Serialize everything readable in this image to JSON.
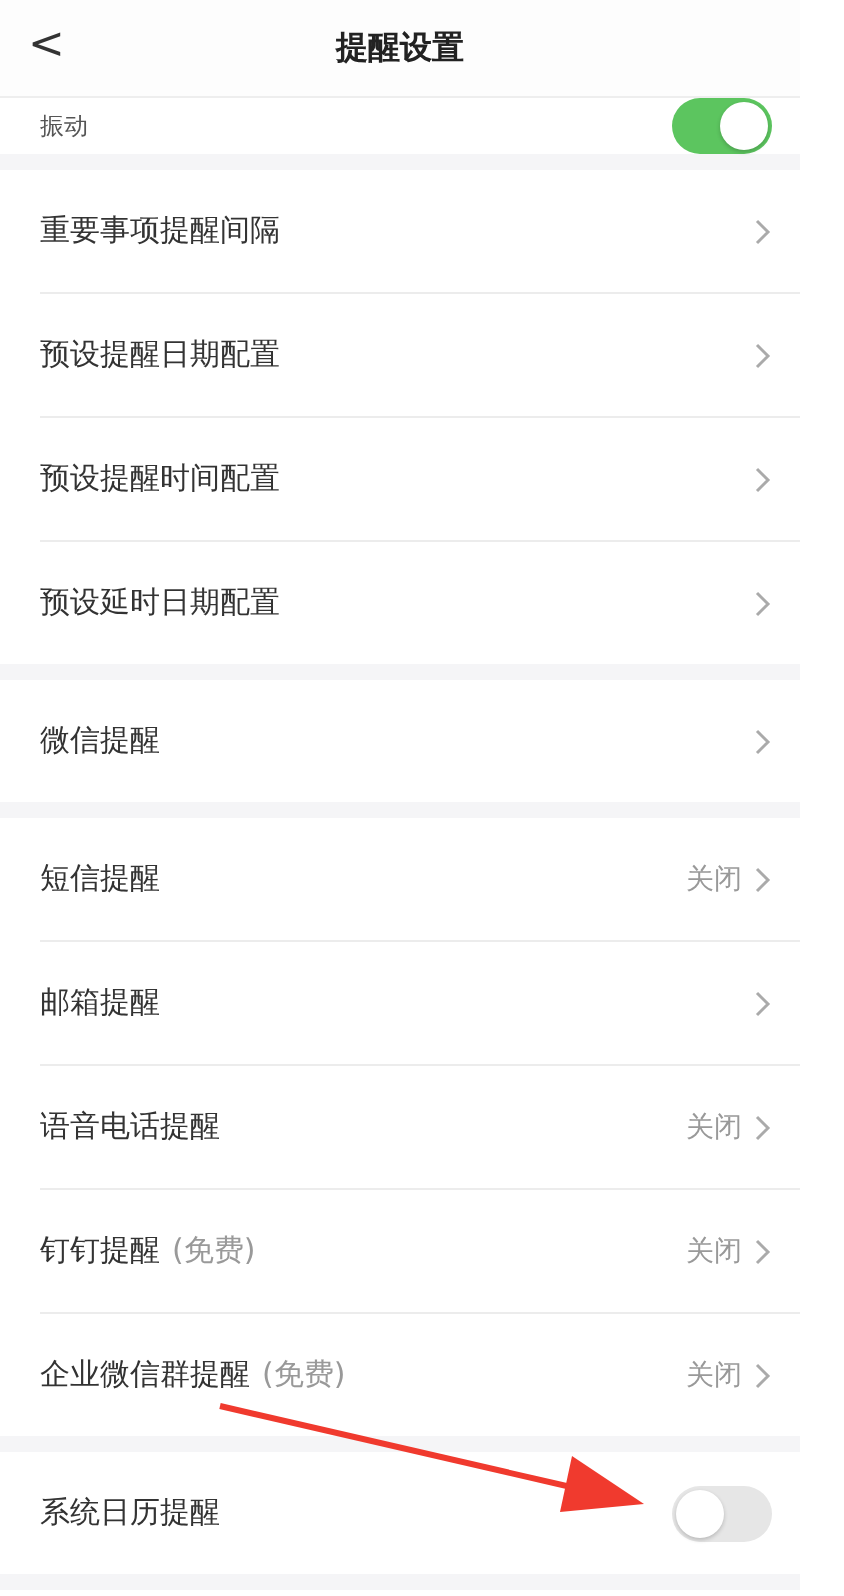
{
  "header": {
    "title": "提醒设置",
    "back": "<"
  },
  "top_row": {
    "label": "振动",
    "on": true
  },
  "groups": [
    {
      "rows": [
        {
          "kind": "link",
          "label": "重要事项提醒间隔"
        },
        {
          "kind": "link",
          "label": "预设提醒日期配置"
        },
        {
          "kind": "link",
          "label": "预设提醒时间配置"
        },
        {
          "kind": "link",
          "label": "预设延时日期配置"
        }
      ]
    },
    {
      "rows": [
        {
          "kind": "link",
          "label": "微信提醒"
        }
      ]
    },
    {
      "rows": [
        {
          "kind": "link",
          "label": "短信提醒",
          "value": "关闭"
        },
        {
          "kind": "link",
          "label": "邮箱提醒"
        },
        {
          "kind": "link",
          "label": "语音电话提醒",
          "value": "关闭"
        },
        {
          "kind": "link",
          "label": "钉钉提醒",
          "note": "(免费)",
          "value": "关闭"
        },
        {
          "kind": "link",
          "label": "企业微信群提醒",
          "note": "(免费)",
          "value": "关闭"
        }
      ]
    },
    {
      "rows": [
        {
          "kind": "switch",
          "label": "系统日历提醒",
          "on": false
        }
      ]
    }
  ]
}
